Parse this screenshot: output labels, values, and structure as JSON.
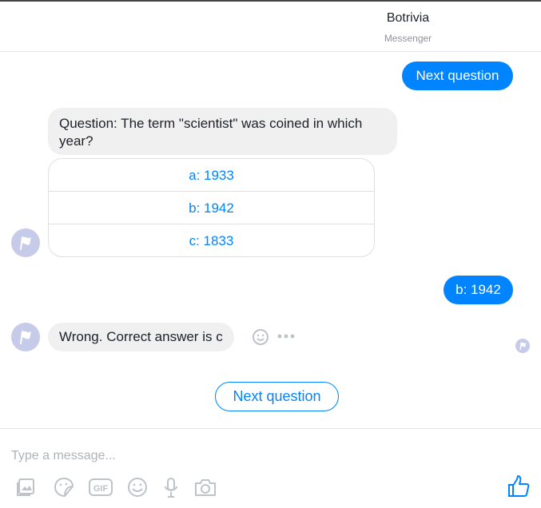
{
  "header": {
    "title": "Botrivia",
    "subtitle": "Messenger"
  },
  "messages": {
    "out_1": "Next question",
    "question": "Question: The term \"scientist\" was coined in which year?",
    "options": [
      "a: 1933",
      "b: 1942",
      "c: 1833"
    ],
    "out_2": "b: 1942",
    "reply": "Wrong. Correct answer is c"
  },
  "quick_reply": {
    "label": "Next question"
  },
  "composer": {
    "placeholder": "Type a message...",
    "tools": [
      "photo-icon",
      "sticker-icon",
      "gif-icon",
      "emoji-icon",
      "microphone-icon",
      "camera-icon"
    ],
    "send_icon": "thumbs-up-icon"
  },
  "colors": {
    "accent": "#0084ff",
    "incoming_bubble": "#f1f0f0",
    "avatar": "#c5cbe8"
  }
}
